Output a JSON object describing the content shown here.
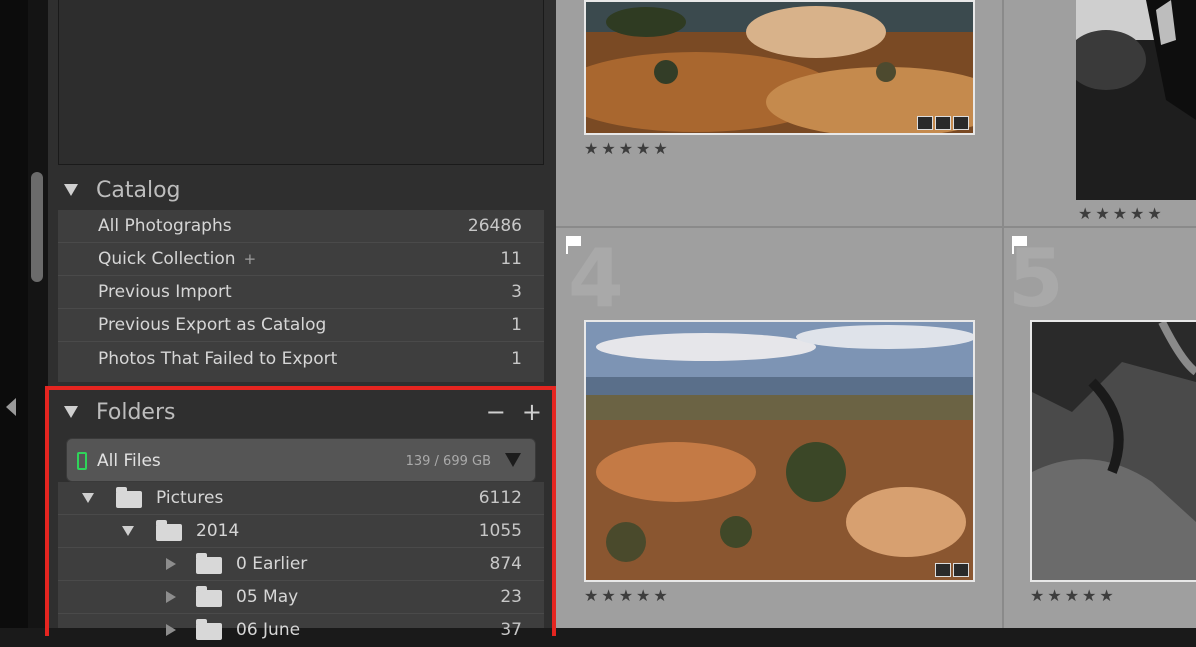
{
  "catalog": {
    "title": "Catalog",
    "items": [
      {
        "label": "All Photographs",
        "count": "26486"
      },
      {
        "label": "Quick Collection",
        "suffix": "+",
        "count": "11"
      },
      {
        "label": "Previous Import",
        "count": "3"
      },
      {
        "label": "Previous Export as Catalog",
        "count": "1"
      },
      {
        "label": "Photos That Failed to Export",
        "count": "1"
      }
    ]
  },
  "folders": {
    "title": "Folders",
    "minus": "−",
    "plus": "+",
    "volume": {
      "label": "All Files",
      "stat": "139 / 699 GB"
    },
    "items": [
      {
        "label": "Pictures",
        "count": "6112"
      },
      {
        "label": "2014",
        "count": "1055"
      },
      {
        "label": "0 Earlier",
        "count": "874"
      },
      {
        "label": "05 May",
        "count": "23"
      },
      {
        "label": "06 June",
        "count": "37"
      }
    ]
  },
  "grid": {
    "cell_numbers": [
      "4",
      "5"
    ],
    "stars": "★★★★★"
  },
  "colors": {
    "highlight": "#e52520",
    "volume_indicator": "#2fd45a"
  }
}
